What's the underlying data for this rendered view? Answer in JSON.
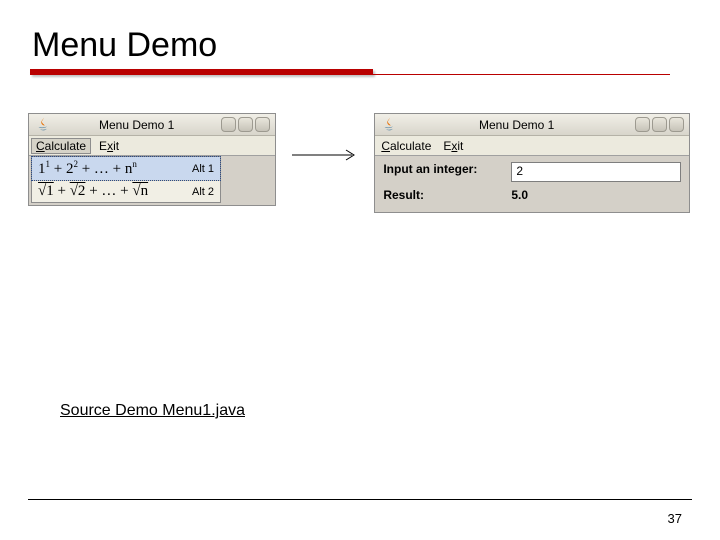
{
  "title": "Menu Demo",
  "left": {
    "title": "Menu Demo 1",
    "menu": {
      "calculate": "Calculate",
      "exit": "Exit"
    },
    "items": [
      {
        "formula_html": "1<span class='sup'>1</span> + 2<span class='sup'>2</span> + … + n<span class='sup'>n</span>",
        "accel": "Alt 1"
      },
      {
        "formula_html": "<span class='over'>√1</span> + <span class='over'>√2</span> + … + <span class='over'>√n</span>",
        "accel": "Alt 2"
      }
    ]
  },
  "right": {
    "title": "Menu Demo 1",
    "menu": {
      "calculate": "Calculate",
      "exit": "Exit"
    },
    "input_label": "Input an integer:",
    "input_value": "2",
    "result_label": "Result:",
    "result_value": "5.0"
  },
  "source_link": "Source Demo Menu1.java",
  "page_number": "37"
}
